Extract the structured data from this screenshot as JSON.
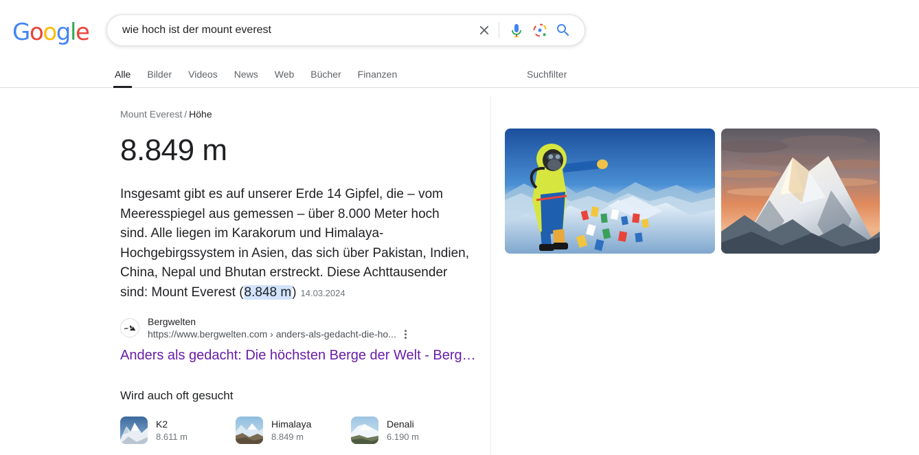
{
  "header": {
    "logo": {
      "name": "Google",
      "letters": [
        "G",
        "o",
        "o",
        "g",
        "l",
        "e"
      ]
    },
    "search": {
      "value": "wie hoch ist der mount everest",
      "placeholder": "Suche",
      "clear_label": "Löschen",
      "voice_label": "Sprachsuche",
      "lens_label": "Suche mit Google Lens",
      "submit_label": "Google Suche"
    },
    "tabs": [
      {
        "label": "Alle",
        "active": true
      },
      {
        "label": "Bilder",
        "active": false
      },
      {
        "label": "Videos",
        "active": false
      },
      {
        "label": "News",
        "active": false
      },
      {
        "label": "Web",
        "active": false
      },
      {
        "label": "Bücher",
        "active": false
      },
      {
        "label": "Finanzen",
        "active": false
      }
    ],
    "filters_label": "Suchfilter"
  },
  "answer_card": {
    "breadcrumb": {
      "entity": "Mount Everest",
      "separator": "/",
      "attribute": "Höhe"
    },
    "value": "8.849 m",
    "snippet": {
      "before": "Insgesamt gibt es auf unserer Erde 14 Gipfel, die – vom Meeresspiegel aus gemessen – über 8.000 Meter hoch sind. Alle liegen im Karakorum und Himalaya-Hochgebirgssystem in Asien, das sich über Pakistan, Indien, China, Nepal und Bhutan erstreckt. Diese Achttausender sind: Mount Everest (",
      "highlight": "8.848 m",
      "after": ")",
      "date": "14.03.2024"
    },
    "source": {
      "site_name": "Bergwelten",
      "url": "https://www.bergwelten.com › anders-als-gedacht-die-ho...",
      "title": "Anders als gedacht: Die höchsten Berge der Welt - Berg…",
      "favicon_name": "bergwelten-mountain-favicon",
      "menu_label": "Über dieses Ergebnis"
    }
  },
  "also_searched": {
    "title": "Wird auch oft gesucht",
    "items": [
      {
        "name": "K2",
        "height": "8.611 m"
      },
      {
        "name": "Himalaya",
        "height": "8.849 m"
      },
      {
        "name": "Denali",
        "height": "6.190 m"
      }
    ]
  },
  "images": [
    {
      "alt": "Bergsteiger auf dem Gipfel des Mount Everest mit Gebetsfahnen"
    },
    {
      "alt": "Verschneiter Berggipfel im Abendrot"
    }
  ],
  "colors": {
    "google_blue": "#4285f4",
    "google_red": "#ea4335",
    "google_yellow": "#fbbc05",
    "google_green": "#34a853",
    "link_visited": "#681da8",
    "highlight_bg": "#d2e3fc",
    "text_primary": "#202124",
    "text_secondary": "#70757a"
  }
}
